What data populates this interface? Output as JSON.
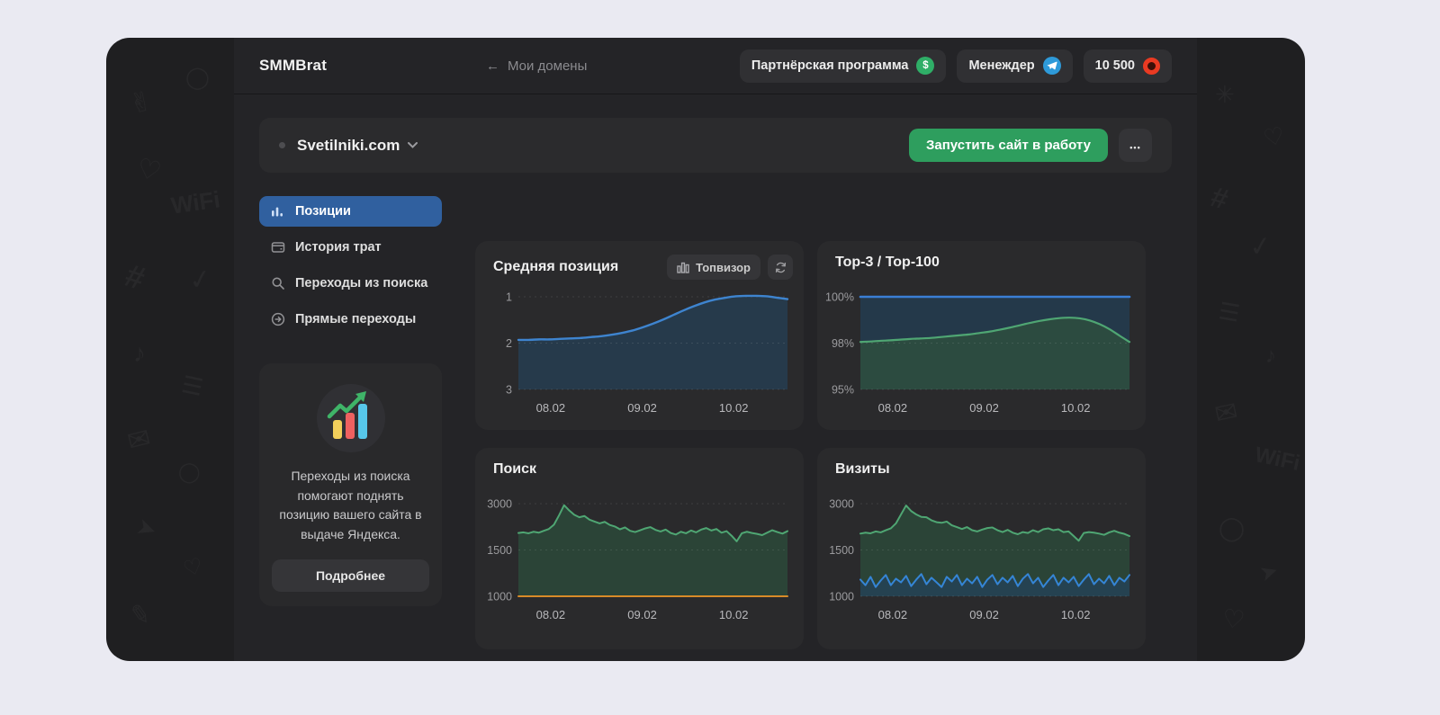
{
  "header": {
    "brand": "SMMBrat",
    "back_arrow": "←",
    "back_label": "Мои домены",
    "partner_label": "Партнёрская программа",
    "manager_label": "Менеждер",
    "balance": "10 500"
  },
  "icons": {
    "dollar": "$"
  },
  "domain_bar": {
    "domain": "Svetilniki.com",
    "launch_label": "Запустить сайт в работу",
    "more_label": "•••"
  },
  "sidebar": {
    "items": [
      {
        "label": "Позиции",
        "active": true
      },
      {
        "label": "История трат",
        "active": false
      },
      {
        "label": "Переходы из поиска",
        "active": false
      },
      {
        "label": "Прямые переходы",
        "active": false
      }
    ]
  },
  "promo": {
    "text": "Переходы из поиска помогают поднять позицию вашего сайта в выдаче Яндекса.",
    "button_label": "Подробнее"
  },
  "colors": {
    "accent_blue": "#30609f",
    "button_green": "#2e9e5e",
    "telegram_blue": "#2e9ad9",
    "dollar_green": "#2fae67",
    "coin_red": "#e93a22",
    "line_blue": "#3e84cf",
    "line_green": "#4fa673",
    "line_orange": "#d88a28"
  },
  "chart_data": [
    {
      "type": "area",
      "title": "Средняя позиция",
      "source_badge": "Топвизор",
      "y_inverted": true,
      "y_ticks": [
        "1",
        "2",
        "3"
      ],
      "x_tick_labels": [
        "08.02",
        "09.02",
        "10.02"
      ],
      "grid": true,
      "series": [
        {
          "color": "#3e84cf",
          "fill": "#263a4b",
          "width": 2.4,
          "smooth": true,
          "values": [
            1.93,
            1.93,
            1.92,
            1.92,
            1.91,
            1.9,
            1.89,
            1.87,
            1.85,
            1.82,
            1.78,
            1.73,
            1.66,
            1.58,
            1.49,
            1.39,
            1.29,
            1.2,
            1.12,
            1.06,
            1.02,
            0.99,
            0.98,
            0.98,
            0.99,
            1.02,
            1.05
          ]
        }
      ]
    },
    {
      "type": "area",
      "title": "Top-3 / Top-100",
      "y_ticks": [
        "100%",
        "98%",
        "95%"
      ],
      "x_tick_labels": [
        "08.02",
        "09.02",
        "10.02"
      ],
      "grid": true,
      "series": [
        {
          "name": "Top-100",
          "color": "#3a7fd5",
          "fill": "#24394a",
          "width": 2.6,
          "smooth": false,
          "values": [
            100,
            100
          ]
        },
        {
          "name": "Top-3",
          "color": "#4fa673",
          "fill": "#2c4b40",
          "width": 2.2,
          "smooth": true,
          "values": [
            98.05,
            98.07,
            98.1,
            98.12,
            98.15,
            98.18,
            98.2,
            98.22,
            98.26,
            98.3,
            98.34,
            98.38,
            98.44,
            98.5,
            98.58,
            98.67,
            98.77,
            98.87,
            98.96,
            99.03,
            99.08,
            99.1,
            99.07,
            98.98,
            98.82,
            98.6,
            98.32,
            98.05
          ]
        }
      ]
    },
    {
      "type": "area",
      "title": "Поиск",
      "y_ticks": [
        "3000",
        "1500",
        "1000"
      ],
      "x_tick_labels": [
        "08.02",
        "09.02",
        "10.02"
      ],
      "grid": true,
      "series": [
        {
          "color": "#4fa673",
          "fill": "#2b4437",
          "width": 2,
          "smooth": false,
          "values": [
            2050,
            2070,
            2040,
            2090,
            2060,
            2120,
            2180,
            2320,
            2620,
            2950,
            2780,
            2640,
            2560,
            2600,
            2480,
            2420,
            2360,
            2410,
            2310,
            2260,
            2170,
            2230,
            2120,
            2080,
            2140,
            2200,
            2240,
            2150,
            2100,
            2160,
            2050,
            2000,
            2090,
            2040,
            2130,
            2070,
            2160,
            2210,
            2130,
            2180,
            2060,
            2110,
            1960,
            1780,
            2040,
            2090,
            2050,
            2020,
            1980,
            2060,
            2140,
            2080,
            2030,
            2110
          ]
        },
        {
          "color": "#d88a28",
          "fill": "none",
          "width": 2,
          "smooth": false,
          "values": [
            1000,
            1000
          ]
        }
      ]
    },
    {
      "type": "area",
      "title": "Визиты",
      "y_ticks": [
        "3000",
        "1500",
        "1000"
      ],
      "x_tick_labels": [
        "08.02",
        "09.02",
        "10.02"
      ],
      "grid": true,
      "series": [
        {
          "color": "#4fa673",
          "fill": "#2b4437",
          "width": 2,
          "smooth": false,
          "values": [
            2030,
            2060,
            2040,
            2100,
            2070,
            2140,
            2200,
            2360,
            2650,
            2940,
            2760,
            2650,
            2570,
            2560,
            2460,
            2400,
            2380,
            2420,
            2300,
            2240,
            2180,
            2240,
            2140,
            2100,
            2160,
            2210,
            2230,
            2140,
            2080,
            2150,
            2060,
            2010,
            2080,
            2050,
            2140,
            2080,
            2170,
            2200,
            2140,
            2170,
            2080,
            2100,
            1950,
            1800,
            2050,
            2080,
            2060,
            2030,
            1990,
            2070,
            2120,
            2060,
            2020,
            1950
          ]
        },
        {
          "color": "#3585d6",
          "fill": "#254251",
          "width": 2,
          "smooth": false,
          "values": [
            1180,
            1120,
            1210,
            1100,
            1170,
            1230,
            1120,
            1190,
            1150,
            1220,
            1110,
            1180,
            1240,
            1130,
            1200,
            1150,
            1100,
            1210,
            1160,
            1230,
            1120,
            1190,
            1140,
            1210,
            1100,
            1180,
            1230,
            1130,
            1200,
            1150,
            1220,
            1110,
            1190,
            1240,
            1140,
            1200,
            1100,
            1170,
            1230,
            1120,
            1200,
            1150,
            1210,
            1110,
            1180,
            1240,
            1130,
            1190,
            1140,
            1220,
            1120,
            1200,
            1160,
            1230
          ]
        }
      ]
    }
  ]
}
